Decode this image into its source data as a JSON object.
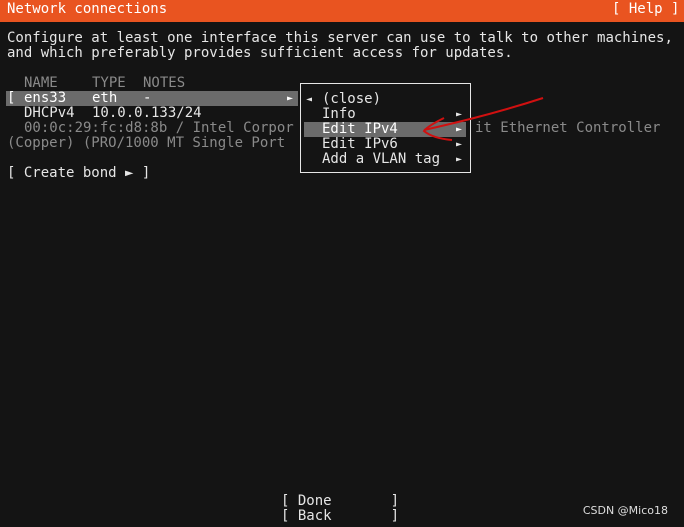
{
  "header": {
    "title": "Network connections",
    "help": "[ Help ]",
    "color": "#e95420"
  },
  "intro": [
    "Configure at least one interface this server can use to talk to other machines,",
    "and which preferably provides sufficient access for updates."
  ],
  "table": {
    "columns": [
      "NAME",
      "TYPE",
      "NOTES"
    ],
    "iface": {
      "bracket": "[",
      "name": "ens33",
      "type": "eth",
      "notes": "-",
      "arrow": "►"
    },
    "addr": {
      "proto": "DHCPv4",
      "ip": "10.0.0.133/24"
    },
    "desc1a": "00:0c:29:fc:d8:8b / Intel Corpor",
    "desc1b": "it Ethernet Controller",
    "desc2": "(Copper) (PRO/1000 MT Single Port"
  },
  "create_bond": "[ Create bond ► ]",
  "menu": {
    "items": [
      {
        "label": "(close)",
        "prefix": "◄"
      },
      {
        "label": "Info",
        "arrow": "►"
      },
      {
        "label": "Edit IPv4",
        "arrow": "►",
        "selected": true
      },
      {
        "label": "Edit IPv6",
        "arrow": "►"
      },
      {
        "label": "Add a VLAN tag",
        "arrow": "►"
      }
    ]
  },
  "buttons": {
    "done": "[ Done       ]",
    "back": "[ Back       ]"
  },
  "watermark": "CSDN @Mico18",
  "annotation_color": "#d01010"
}
